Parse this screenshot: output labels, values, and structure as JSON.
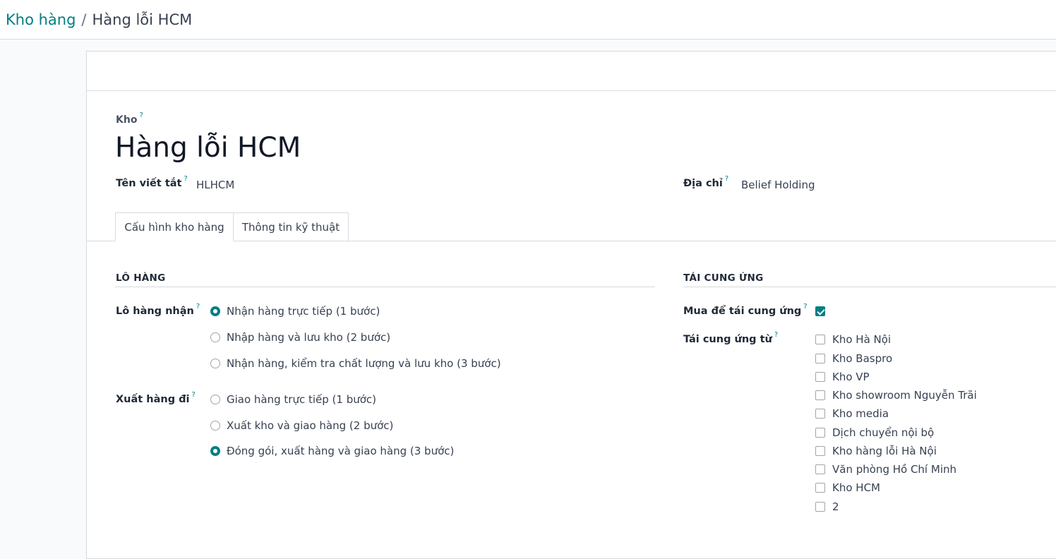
{
  "breadcrumb": {
    "parent": "Kho hàng",
    "separator": "/",
    "current": "Hàng lỗi HCM"
  },
  "record": {
    "model_label": "Kho",
    "name": "Hàng lỗi HCM",
    "short_name_label": "Tên viết tắt",
    "short_name_value": "HLHCM",
    "address_label": "Địa chỉ",
    "address_value": "Belief Holding"
  },
  "help_mark": "?",
  "tabs": [
    {
      "label": "Cấu hình kho hàng",
      "active": true
    },
    {
      "label": "Thông tin kỹ thuật",
      "active": false
    }
  ],
  "shipments": {
    "title": "LÔ HÀNG",
    "incoming": {
      "label": "Lô hàng nhận",
      "options": [
        {
          "label": "Nhận hàng trực tiếp (1 bước)",
          "selected": true
        },
        {
          "label": "Nhập hàng và lưu kho (2 bước)",
          "selected": false
        },
        {
          "label": "Nhận hàng, kiểm tra chất lượng và lưu kho (3 bước)",
          "selected": false
        }
      ]
    },
    "outgoing": {
      "label": "Xuất hàng đi",
      "options": [
        {
          "label": "Giao hàng trực tiếp (1 bước)",
          "selected": false
        },
        {
          "label": "Xuất kho và giao hàng (2 bước)",
          "selected": false
        },
        {
          "label": "Đóng gói, xuất hàng và giao hàng (3 bước)",
          "selected": true
        }
      ]
    }
  },
  "resupply": {
    "title": "TÁI CUNG ỨNG",
    "buy_label": "Mua để tái cung ứng",
    "buy_checked": true,
    "from_label": "Tái cung ứng từ",
    "warehouses": [
      {
        "label": "Kho Hà Nội",
        "checked": false
      },
      {
        "label": "Kho Baspro",
        "checked": false
      },
      {
        "label": "Kho VP",
        "checked": false
      },
      {
        "label": "Kho showroom Nguyễn Trãi",
        "checked": false
      },
      {
        "label": "Kho media",
        "checked": false
      },
      {
        "label": "Dịch chuyển nội bộ",
        "checked": false
      },
      {
        "label": "Kho hàng lỗi Hà Nội",
        "checked": false
      },
      {
        "label": "Văn phòng Hồ Chí Minh",
        "checked": false
      },
      {
        "label": "Kho HCM",
        "checked": false
      },
      {
        "label": "2",
        "checked": false
      }
    ]
  },
  "colors": {
    "accent": "#017e84",
    "border": "#d8dadd",
    "background": "#f9fafb"
  }
}
